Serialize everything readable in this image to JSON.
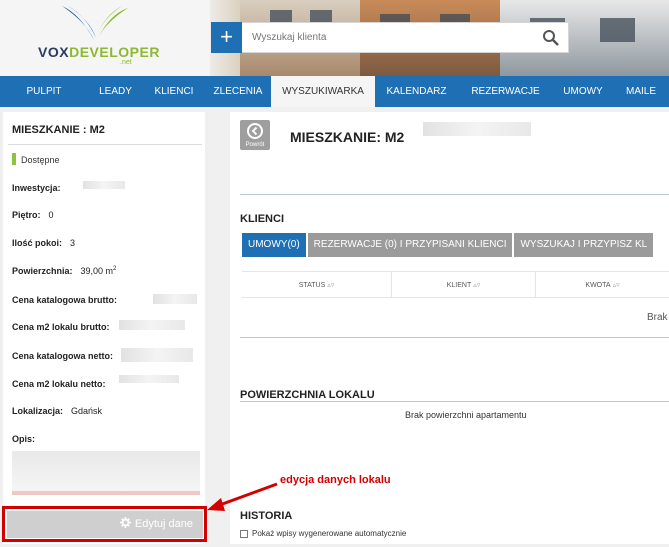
{
  "logo": {
    "brand_a": "VOX",
    "brand_b": "DEVELOPER",
    "suffix": ".net"
  },
  "search": {
    "plus": "+",
    "placeholder": "Wyszukaj klienta"
  },
  "nav": {
    "items": [
      {
        "label": "PULPIT"
      },
      {
        "label": "LEADY"
      },
      {
        "label": "KLIENCI"
      },
      {
        "label": "ZLECENIA"
      },
      {
        "label": "WYSZUKIWARKA",
        "active": true
      },
      {
        "label": "KALENDARZ"
      },
      {
        "label": "REZERWACJE"
      },
      {
        "label": "UMOWY"
      },
      {
        "label": "MAILE"
      }
    ]
  },
  "left": {
    "title": "MIESZKANIE : M2",
    "status": "Dostępne",
    "status_color": "#8cc43c",
    "fields": {
      "inwestycja": "Inwestycja:",
      "pietro": "Piętro:",
      "pietro_val": "0",
      "pokoje": "Ilość pokoi:",
      "pokoje_val": "3",
      "powierzchnia": "Powierzchnia:",
      "powierzchnia_val": "39,00 m",
      "powierzchnia_sup": "2",
      "cena_kat_brutto": "Cena katalogowa brutto:",
      "cena_m2_brutto": "Cena m2 lokalu brutto:",
      "cena_kat_netto": "Cena katalogowa netto:",
      "cena_m2_netto": "Cena m2 lokalu netto:",
      "lokalizacja": "Lokalizacja:",
      "lokalizacja_val": "Gdańsk",
      "opis": "Opis:"
    },
    "edit_button": "Edytuj dane"
  },
  "right": {
    "back_label": "Powrót",
    "title": "MIESZKANIE: M2",
    "clients_title": "KLIENCI",
    "tabs": [
      "UMOWY(0)",
      "REZERWACJE (0) I PRZYPISANI KLIENCI",
      "WYSZUKAJ I PRZYPISZ KL"
    ],
    "table_headers": [
      "STATUS",
      "KLIENT",
      "KWOTA"
    ],
    "empty_row": "Brak",
    "area_title": "POWIERZCHNIA LOKALU",
    "area_empty": "Brak powierzchni apartamentu",
    "history_title": "HISTORIA",
    "history_checkbox": "Pokaż wpisy wygenerowane automatycznie"
  },
  "annotation": {
    "text": "edycja danych lokalu",
    "color": "#d40000"
  },
  "colors": {
    "primary": "#1f6fb5",
    "accent_green": "#8cc43c"
  }
}
